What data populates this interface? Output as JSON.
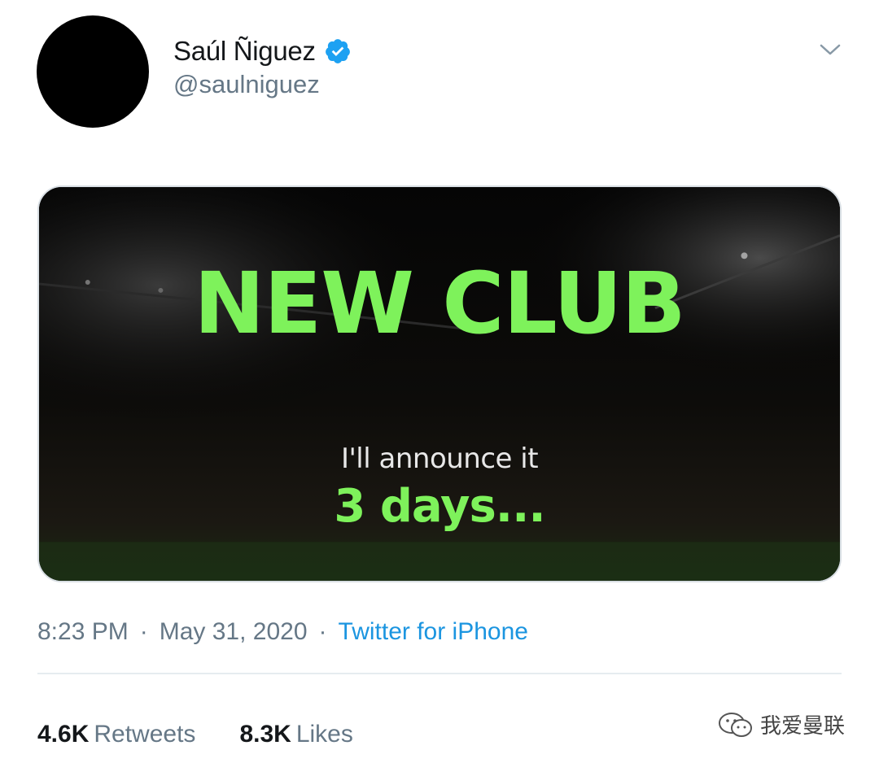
{
  "tweet": {
    "author": {
      "display_name": "Saúl Ñiguez",
      "handle": "@saulniguez",
      "verified": true
    },
    "media": {
      "headline": "NEW CLUB",
      "subtext": "I'll announce it",
      "countdown": "3 days..."
    },
    "meta": {
      "time": "8:23 PM",
      "separator": "·",
      "date": "May 31, 2020",
      "source": "Twitter for iPhone"
    },
    "stats": {
      "retweets_count": "4.6K",
      "retweets_label": "Retweets",
      "likes_count": "8.3K",
      "likes_label": "Likes"
    }
  },
  "watermark": {
    "text": "我爱曼联"
  },
  "colors": {
    "accent_blue": "#1b95e0",
    "headline_green": "#7ef25b",
    "muted_gray": "#657786"
  }
}
